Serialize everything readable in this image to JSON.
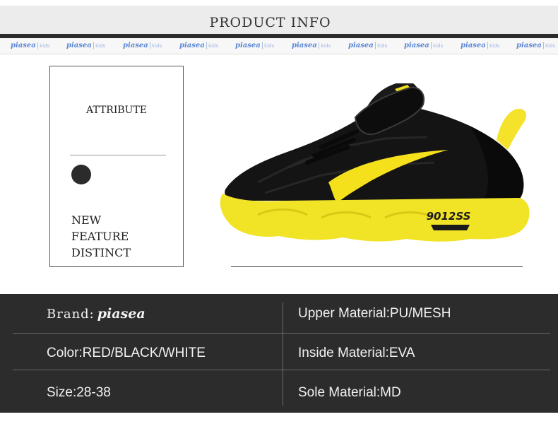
{
  "header": {
    "title": "PRODUCT  INFO"
  },
  "brand_strip": {
    "items": [
      {
        "name": "piasea",
        "sub": "kids"
      },
      {
        "name": "piasea",
        "sub": "kids"
      },
      {
        "name": "piasea",
        "sub": "kids"
      },
      {
        "name": "piasea",
        "sub": "kids"
      },
      {
        "name": "piasea",
        "sub": "kids"
      },
      {
        "name": "piasea",
        "sub": "kids"
      },
      {
        "name": "piasea",
        "sub": "kids"
      },
      {
        "name": "piasea",
        "sub": "kids"
      },
      {
        "name": "piasea",
        "sub": "kids"
      },
      {
        "name": "piasea",
        "sub": "kids"
      }
    ]
  },
  "attribute": {
    "title": "ATTRIBUTE",
    "features": [
      "NEW",
      "FEATURE",
      "DISTINCT"
    ]
  },
  "shoe": {
    "model_text": "9012SS",
    "colors": {
      "upper": "#111111",
      "accent": "#f5e01c",
      "sole": "#f1e326"
    }
  },
  "specs": {
    "brand_label": "Brand:",
    "brand_logo": "piasea",
    "rows": [
      {
        "left": "",
        "right": "Upper Material:PU/MESH"
      },
      {
        "left": "Color:RED/BLACK/WHITE",
        "right": "Inside Material:EVA"
      },
      {
        "left": "Size:28-38",
        "right": "Sole Material:MD"
      }
    ]
  }
}
